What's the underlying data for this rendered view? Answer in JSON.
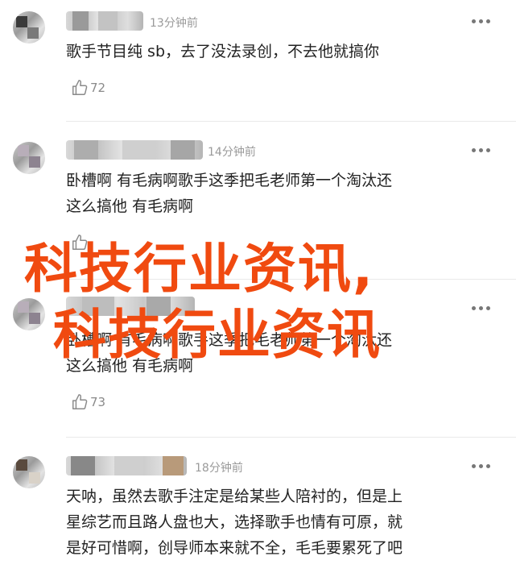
{
  "comments": [
    {
      "time": "13分钟前",
      "text": "歌手节目纯 sb，去了没法录创，不去他就搞你",
      "likes": "72"
    },
    {
      "time": "14分钟前",
      "text": "卧槽啊 有毛病啊歌手这季把毛老师第一个淘汰还\n这么搞他 有毛病啊",
      "likes": ""
    },
    {
      "time": "",
      "text": "卧槽啊 有毛病啊歌手这季把毛老师第一个淘汰还\n这么搞他 有毛病啊",
      "likes": "73"
    },
    {
      "time": "18分钟前",
      "text": "天呐，虽然去歌手注定是给某些人陪衬的，但是上\n星综艺而且路人盘也大，选择歌手也情有可原，就\n是好可惜啊，创导师本来就不全，毛毛要累死了吧"
    }
  ],
  "watermark": {
    "line1": "科技行业资讯,",
    "line2": "科技行业资讯"
  },
  "colors": {
    "watermark": "#f04a10",
    "meta": "#9a9a9a",
    "text": "#222222"
  },
  "icons": {
    "like": "thumbs-up-icon",
    "more": "more-dots-icon"
  }
}
